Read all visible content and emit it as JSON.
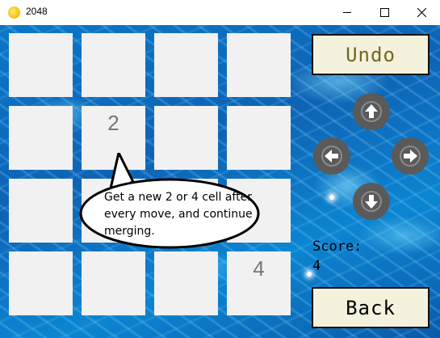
{
  "window": {
    "title": "2048",
    "app_icon": "coin-icon",
    "controls": [
      "minimize-icon",
      "maximize-icon",
      "close-icon"
    ]
  },
  "board": {
    "rows": [
      [
        "",
        "",
        "",
        ""
      ],
      [
        "",
        "2",
        "",
        ""
      ],
      [
        "",
        "",
        "",
        ""
      ],
      [
        "",
        "",
        "",
        "4"
      ]
    ],
    "tile_color": "#f1f1f1",
    "number_color": "#777777"
  },
  "hint": {
    "text": "Get a new 2 or 4 cell after every move, and continue merging."
  },
  "controls": {
    "undo_label": "Undo",
    "back_label": "Back",
    "arrow_icons": [
      "arrow-up-icon",
      "arrow-left-icon",
      "arrow-right-icon",
      "arrow-down-icon"
    ],
    "arrow_color": "#5a5a5a"
  },
  "score": {
    "label": "Score:",
    "value": "4"
  }
}
